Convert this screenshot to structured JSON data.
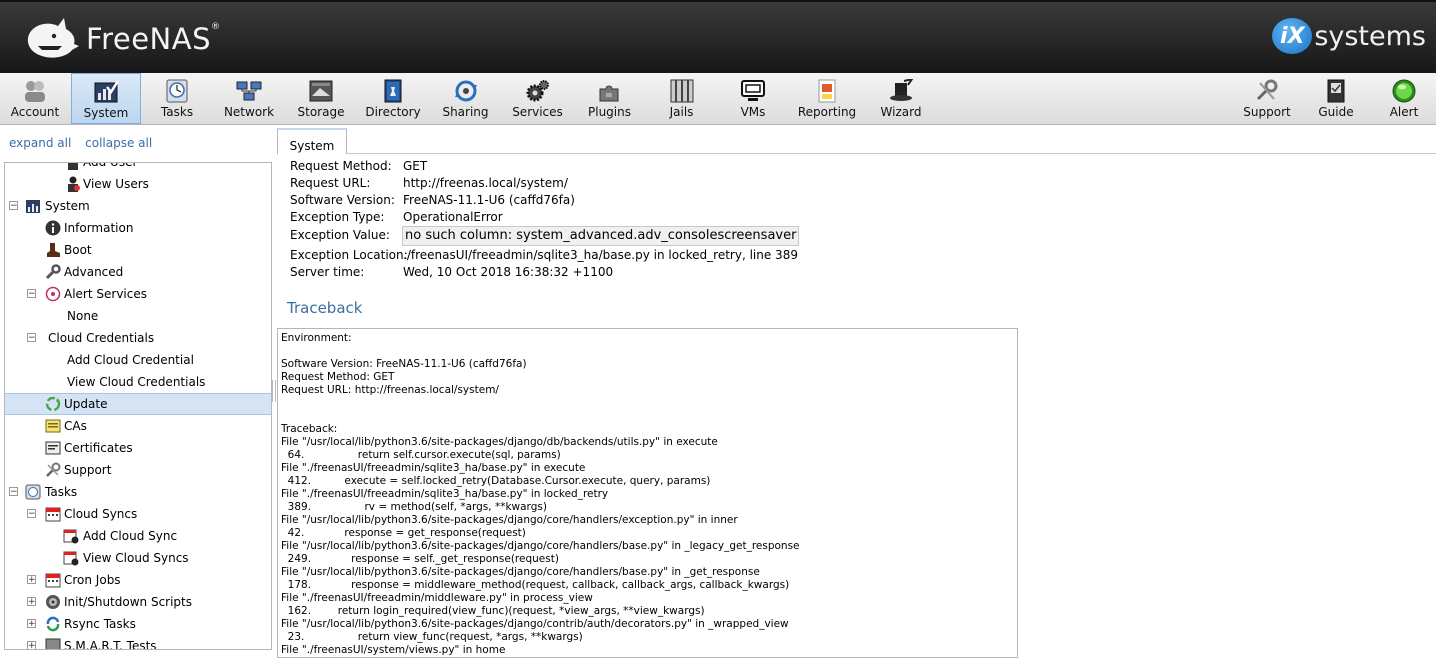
{
  "header": {
    "logo_text": "FreeNAS",
    "logo_reg": "®",
    "ix_mark": "iX",
    "ix_text": "systems"
  },
  "toolbar": {
    "items": [
      {
        "label": "Account",
        "icon": "account-icon"
      },
      {
        "label": "System",
        "icon": "system-icon",
        "active": true
      },
      {
        "label": "Tasks",
        "icon": "tasks-icon"
      },
      {
        "label": "Network",
        "icon": "network-icon"
      },
      {
        "label": "Storage",
        "icon": "storage-icon"
      },
      {
        "label": "Directory",
        "icon": "directory-icon"
      },
      {
        "label": "Sharing",
        "icon": "sharing-icon"
      },
      {
        "label": "Services",
        "icon": "services-icon"
      },
      {
        "label": "Plugins",
        "icon": "plugins-icon"
      },
      {
        "label": "Jails",
        "icon": "jails-icon"
      },
      {
        "label": "VMs",
        "icon": "vms-icon"
      },
      {
        "label": "Reporting",
        "icon": "reporting-icon"
      },
      {
        "label": "Wizard",
        "icon": "wizard-icon"
      }
    ],
    "right_items": [
      {
        "label": "Support",
        "icon": "support-icon"
      },
      {
        "label": "Guide",
        "icon": "guide-icon"
      },
      {
        "label": "Alert",
        "icon": "alert-icon"
      }
    ]
  },
  "left": {
    "expand_all": "expand all",
    "collapse_all": "collapse all",
    "tree": [
      {
        "label": "Add User",
        "icon": "user-add-icon"
      },
      {
        "label": "View Users",
        "icon": "users-icon"
      },
      {
        "label": "System",
        "icon": "system-icon",
        "toggle": "−"
      },
      {
        "label": "Information",
        "icon": "info-icon"
      },
      {
        "label": "Boot",
        "icon": "boot-icon"
      },
      {
        "label": "Advanced",
        "icon": "wrench-icon"
      },
      {
        "label": "Alert Services",
        "icon": "alert-services-icon",
        "toggle": "−"
      },
      {
        "label": "None"
      },
      {
        "label": "Cloud Credentials",
        "toggle": "−"
      },
      {
        "label": "Add Cloud Credential"
      },
      {
        "label": "View Cloud Credentials"
      },
      {
        "label": "Update",
        "icon": "update-icon",
        "selected": true
      },
      {
        "label": "CAs",
        "icon": "ca-icon"
      },
      {
        "label": "Certificates",
        "icon": "certificate-icon"
      },
      {
        "label": "Support",
        "icon": "support-icon"
      },
      {
        "label": "Tasks",
        "icon": "tasks-icon",
        "toggle": "−"
      },
      {
        "label": "Cloud Syncs",
        "icon": "calendar-icon",
        "toggle": "−"
      },
      {
        "label": "Add Cloud Sync",
        "icon": "calendar-add-icon"
      },
      {
        "label": "View Cloud Syncs",
        "icon": "calendar-add-icon"
      },
      {
        "label": "Cron Jobs",
        "icon": "calendar-icon",
        "toggle": "+"
      },
      {
        "label": "Init/Shutdown Scripts",
        "icon": "init-icon",
        "toggle": "+"
      },
      {
        "label": "Rsync Tasks",
        "icon": "rsync-icon",
        "toggle": "+"
      },
      {
        "label": "S.M.A.R.T. Tests",
        "icon": "smart-icon",
        "toggle": "+"
      }
    ]
  },
  "main": {
    "tab": "System",
    "request_method_label": "Request Method:",
    "request_method": "GET",
    "request_url_label": "Request URL:",
    "request_url": "http://freenas.local/system/",
    "software_version_label": "Software Version:",
    "software_version": "FreeNAS-11.1-U6 (caffd76fa)",
    "exception_type_label": "Exception Type:",
    "exception_type": "OperationalError",
    "exception_value_label": "Exception Value:",
    "exception_value": "no such column: system_advanced.adv_consolescreensaver",
    "exception_location_label": "Exception Location:",
    "exception_location": "./freenasUI/freeadmin/sqlite3_ha/base.py in locked_retry, line 389",
    "server_time_label": "Server time:",
    "server_time": "Wed, 10 Oct 2018 16:38:32 +1100",
    "traceback_title": "Traceback",
    "traceback_text": "Environment:\n\nSoftware Version: FreeNAS-11.1-U6 (caffd76fa)\nRequest Method: GET\nRequest URL: http://freenas.local/system/\n\n\nTraceback:\nFile \"/usr/local/lib/python3.6/site-packages/django/db/backends/utils.py\" in execute\n  64.                return self.cursor.execute(sql, params)\nFile \"./freenasUI/freeadmin/sqlite3_ha/base.py\" in execute\n  412.          execute = self.locked_retry(Database.Cursor.execute, query, params)\nFile \"./freenasUI/freeadmin/sqlite3_ha/base.py\" in locked_retry\n  389.                rv = method(self, *args, **kwargs)\nFile \"/usr/local/lib/python3.6/site-packages/django/core/handlers/exception.py\" in inner\n  42.            response = get_response(request)\nFile \"/usr/local/lib/python3.6/site-packages/django/core/handlers/base.py\" in _legacy_get_response\n  249.            response = self._get_response(request)\nFile \"/usr/local/lib/python3.6/site-packages/django/core/handlers/base.py\" in _get_response\n  178.            response = middleware_method(request, callback, callback_args, callback_kwargs)\nFile \"./freenasUI/freeadmin/middleware.py\" in process_view\n  162.        return login_required(view_func)(request, *view_args, **view_kwargs)\nFile \"/usr/local/lib/python3.6/site-packages/django/contrib/auth/decorators.py\" in _wrapped_view\n  23.                return view_func(request, *args, **kwargs)\nFile \"./freenasUI/system/views.py\" in home"
  }
}
